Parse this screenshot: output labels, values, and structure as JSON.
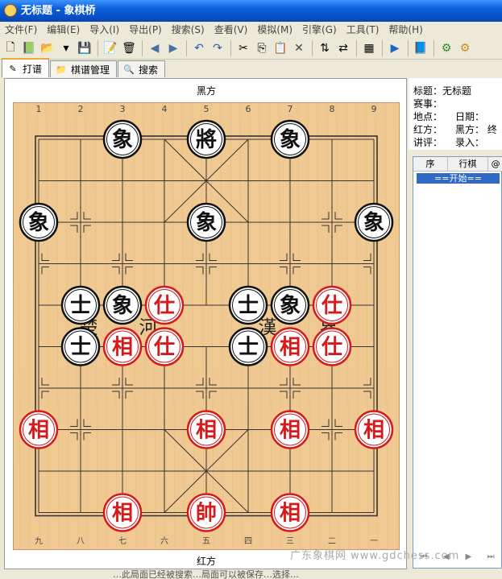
{
  "window": {
    "title": "无标题 - 象棋桥"
  },
  "menu": [
    "文件(F)",
    "编辑(E)",
    "导入(I)",
    "导出(P)",
    "搜索(S)",
    "查看(V)",
    "模拟(M)",
    "引擎(G)",
    "工具(T)",
    "帮助(H)"
  ],
  "toolbar": [
    "new-file",
    "open",
    "open-folder",
    "dropdown",
    "save",
    "page-edit",
    "delete",
    "back",
    "forward",
    "undo",
    "redo",
    "cut",
    "copy",
    "paste",
    "close",
    "flip-vertical",
    "flip-horizontal",
    "board-view",
    "play",
    "book",
    "engine",
    "engine-pair"
  ],
  "tabs": [
    {
      "label": "打谱",
      "active": true
    },
    {
      "label": "棋谱管理",
      "active": false
    },
    {
      "label": "搜索",
      "active": false
    }
  ],
  "board": {
    "top_side": "黑方",
    "bottom_side": "红方",
    "top_coords": [
      "1",
      "2",
      "3",
      "4",
      "5",
      "6",
      "7",
      "8",
      "9"
    ],
    "bottom_coords": [
      "九",
      "八",
      "七",
      "六",
      "五",
      "四",
      "三",
      "二",
      "一"
    ],
    "river_text": [
      "楚",
      "河",
      "漢",
      "界"
    ],
    "colors": {
      "wood": "#f0c992",
      "red": "#d41a1a",
      "black": "#111111"
    },
    "pieces": [
      {
        "side": "black",
        "char": "象",
        "file": 2,
        "rank": 0
      },
      {
        "side": "black",
        "char": "將",
        "file": 4,
        "rank": 0
      },
      {
        "side": "black",
        "char": "象",
        "file": 6,
        "rank": 0
      },
      {
        "side": "black",
        "char": "象",
        "file": 0,
        "rank": 2
      },
      {
        "side": "black",
        "char": "象",
        "file": 4,
        "rank": 2
      },
      {
        "side": "black",
        "char": "象",
        "file": 8,
        "rank": 2
      },
      {
        "side": "black",
        "char": "士",
        "file": 1,
        "rank": 4
      },
      {
        "side": "black",
        "char": "象",
        "file": 2,
        "rank": 4
      },
      {
        "side": "red",
        "char": "仕",
        "file": 3,
        "rank": 4
      },
      {
        "side": "black",
        "char": "士",
        "file": 5,
        "rank": 4
      },
      {
        "side": "black",
        "char": "象",
        "file": 6,
        "rank": 4
      },
      {
        "side": "red",
        "char": "仕",
        "file": 7,
        "rank": 4
      },
      {
        "side": "black",
        "char": "士",
        "file": 1,
        "rank": 5
      },
      {
        "side": "red",
        "char": "相",
        "file": 2,
        "rank": 5
      },
      {
        "side": "red",
        "char": "仕",
        "file": 3,
        "rank": 5
      },
      {
        "side": "black",
        "char": "士",
        "file": 5,
        "rank": 5
      },
      {
        "side": "red",
        "char": "相",
        "file": 6,
        "rank": 5
      },
      {
        "side": "red",
        "char": "仕",
        "file": 7,
        "rank": 5
      },
      {
        "side": "red",
        "char": "相",
        "file": 0,
        "rank": 7
      },
      {
        "side": "red",
        "char": "相",
        "file": 4,
        "rank": 7
      },
      {
        "side": "red",
        "char": "相",
        "file": 6,
        "rank": 7
      },
      {
        "side": "red",
        "char": "相",
        "file": 8,
        "rank": 7
      },
      {
        "side": "red",
        "char": "相",
        "file": 2,
        "rank": 9
      },
      {
        "side": "red",
        "char": "帥",
        "file": 4,
        "rank": 9
      },
      {
        "side": "red",
        "char": "相",
        "file": 6,
        "rank": 9
      }
    ]
  },
  "info": {
    "title_label": "标题：",
    "title_value": "无标题",
    "event_label": "赛事：",
    "place_label": "地点：",
    "date_label": "日期：",
    "red_label": "红方：",
    "black_label": "黑方：",
    "black_value_partial": "终",
    "commentator_label": "讲评：",
    "recorder_label": "录入："
  },
  "moves": {
    "headers": [
      "序",
      "行棋",
      "@"
    ],
    "first_row": "==开始=="
  },
  "nav": [
    "first",
    "prev",
    "next",
    "last"
  ],
  "watermark": "广东象棋网 www.gdchess.com",
  "status_text": "…此局面已经被搜索…局面可以被保存…选择…"
}
